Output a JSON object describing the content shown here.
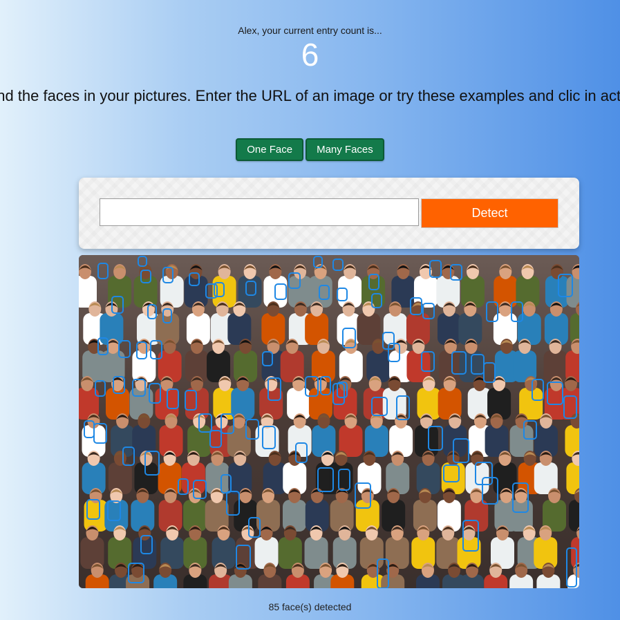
{
  "header": {
    "greeting": "Alex, your current entry count is...",
    "entry_count": "6",
    "intro": "ill find the faces in your pictures. Enter the URL of an image or try these examples and clic in action!"
  },
  "examples": {
    "one_face_label": "One Face",
    "many_faces_label": "Many Faces"
  },
  "form": {
    "url_value": "",
    "url_placeholder": "",
    "detect_label": "Detect"
  },
  "result": {
    "image_subject": "crowd photo",
    "face_box_color": "#1e88e5",
    "status": "85 face(s) detected"
  },
  "colors": {
    "example_button": "#137a4a",
    "detect_button": "#ff6200",
    "count_text": "#ffffff"
  }
}
